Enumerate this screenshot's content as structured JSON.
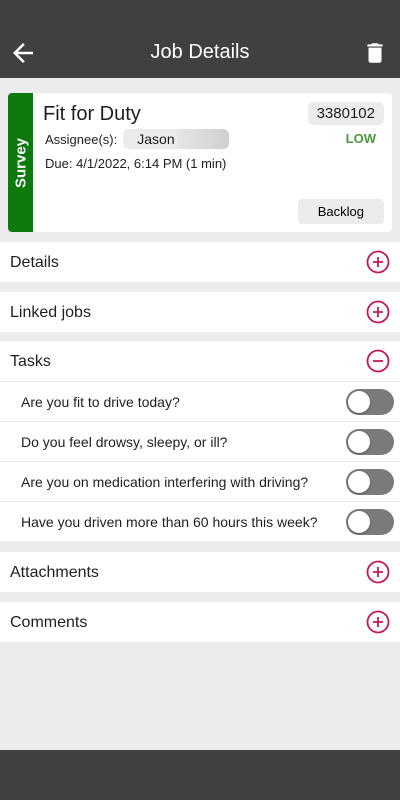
{
  "appbar": {
    "title": "Job Details",
    "back_icon": "arrow-left-icon",
    "delete_icon": "trash-icon"
  },
  "job": {
    "type": "Survey",
    "title": "Fit for Duty",
    "id": "3380102",
    "priority": "LOW",
    "assignee_label": "Assignee(s):",
    "assignee_name": "Jason",
    "due": "Due: 4/1/2022, 6:14 PM (1 min)",
    "status_button": "Backlog"
  },
  "sections": {
    "details": "Details",
    "linked_jobs": "Linked jobs",
    "tasks": "Tasks",
    "attachments": "Attachments",
    "comments": "Comments"
  },
  "tasks": [
    {
      "question": "Are you fit to drive today?",
      "checked": false
    },
    {
      "question": "Do you feel drowsy, sleepy, or ill?",
      "checked": false
    },
    {
      "question": "Are you on medication interfering with driving?",
      "checked": false
    },
    {
      "question": "Have you driven more than 60 hours this week?",
      "checked": false
    }
  ],
  "colors": {
    "appbar": "#404040",
    "survey_stripe": "#0e7a0d",
    "priority_low": "#4b9a3a",
    "accent_icon": "#c2185b",
    "background": "#ececec"
  }
}
